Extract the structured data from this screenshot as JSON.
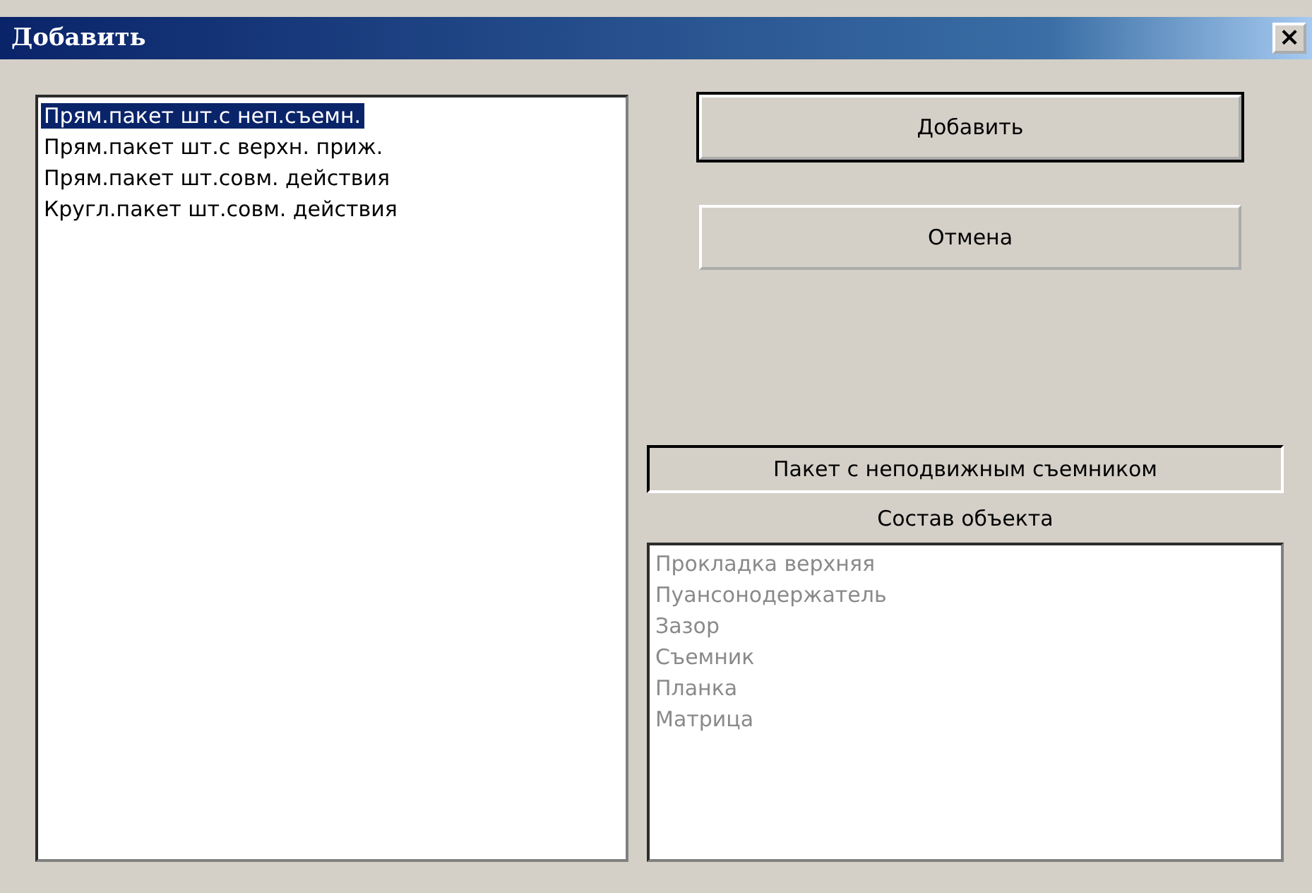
{
  "window": {
    "title": "Добавить",
    "close": "×"
  },
  "objects": {
    "items": [
      {
        "label": "Прям.пакет шт.с неп.съемн.",
        "selected": true
      },
      {
        "label": "Прям.пакет шт.с верхн. приж.",
        "selected": false
      },
      {
        "label": "Прям.пакет шт.совм. действия",
        "selected": false
      },
      {
        "label": "Кругл.пакет шт.совм. действия",
        "selected": false
      }
    ]
  },
  "buttons": [
    {
      "label": "Добавить",
      "default": true
    },
    {
      "label": "Отмена",
      "default": false
    }
  ],
  "object_name": "Пакет с неподвижным съемником",
  "composition": {
    "title": "Состав объекта",
    "disabled": true,
    "items": [
      "Прокладка верхняя",
      "Пуансонодержатель",
      "Зазор",
      "Съемник",
      "Планка",
      "Матрица"
    ]
  }
}
